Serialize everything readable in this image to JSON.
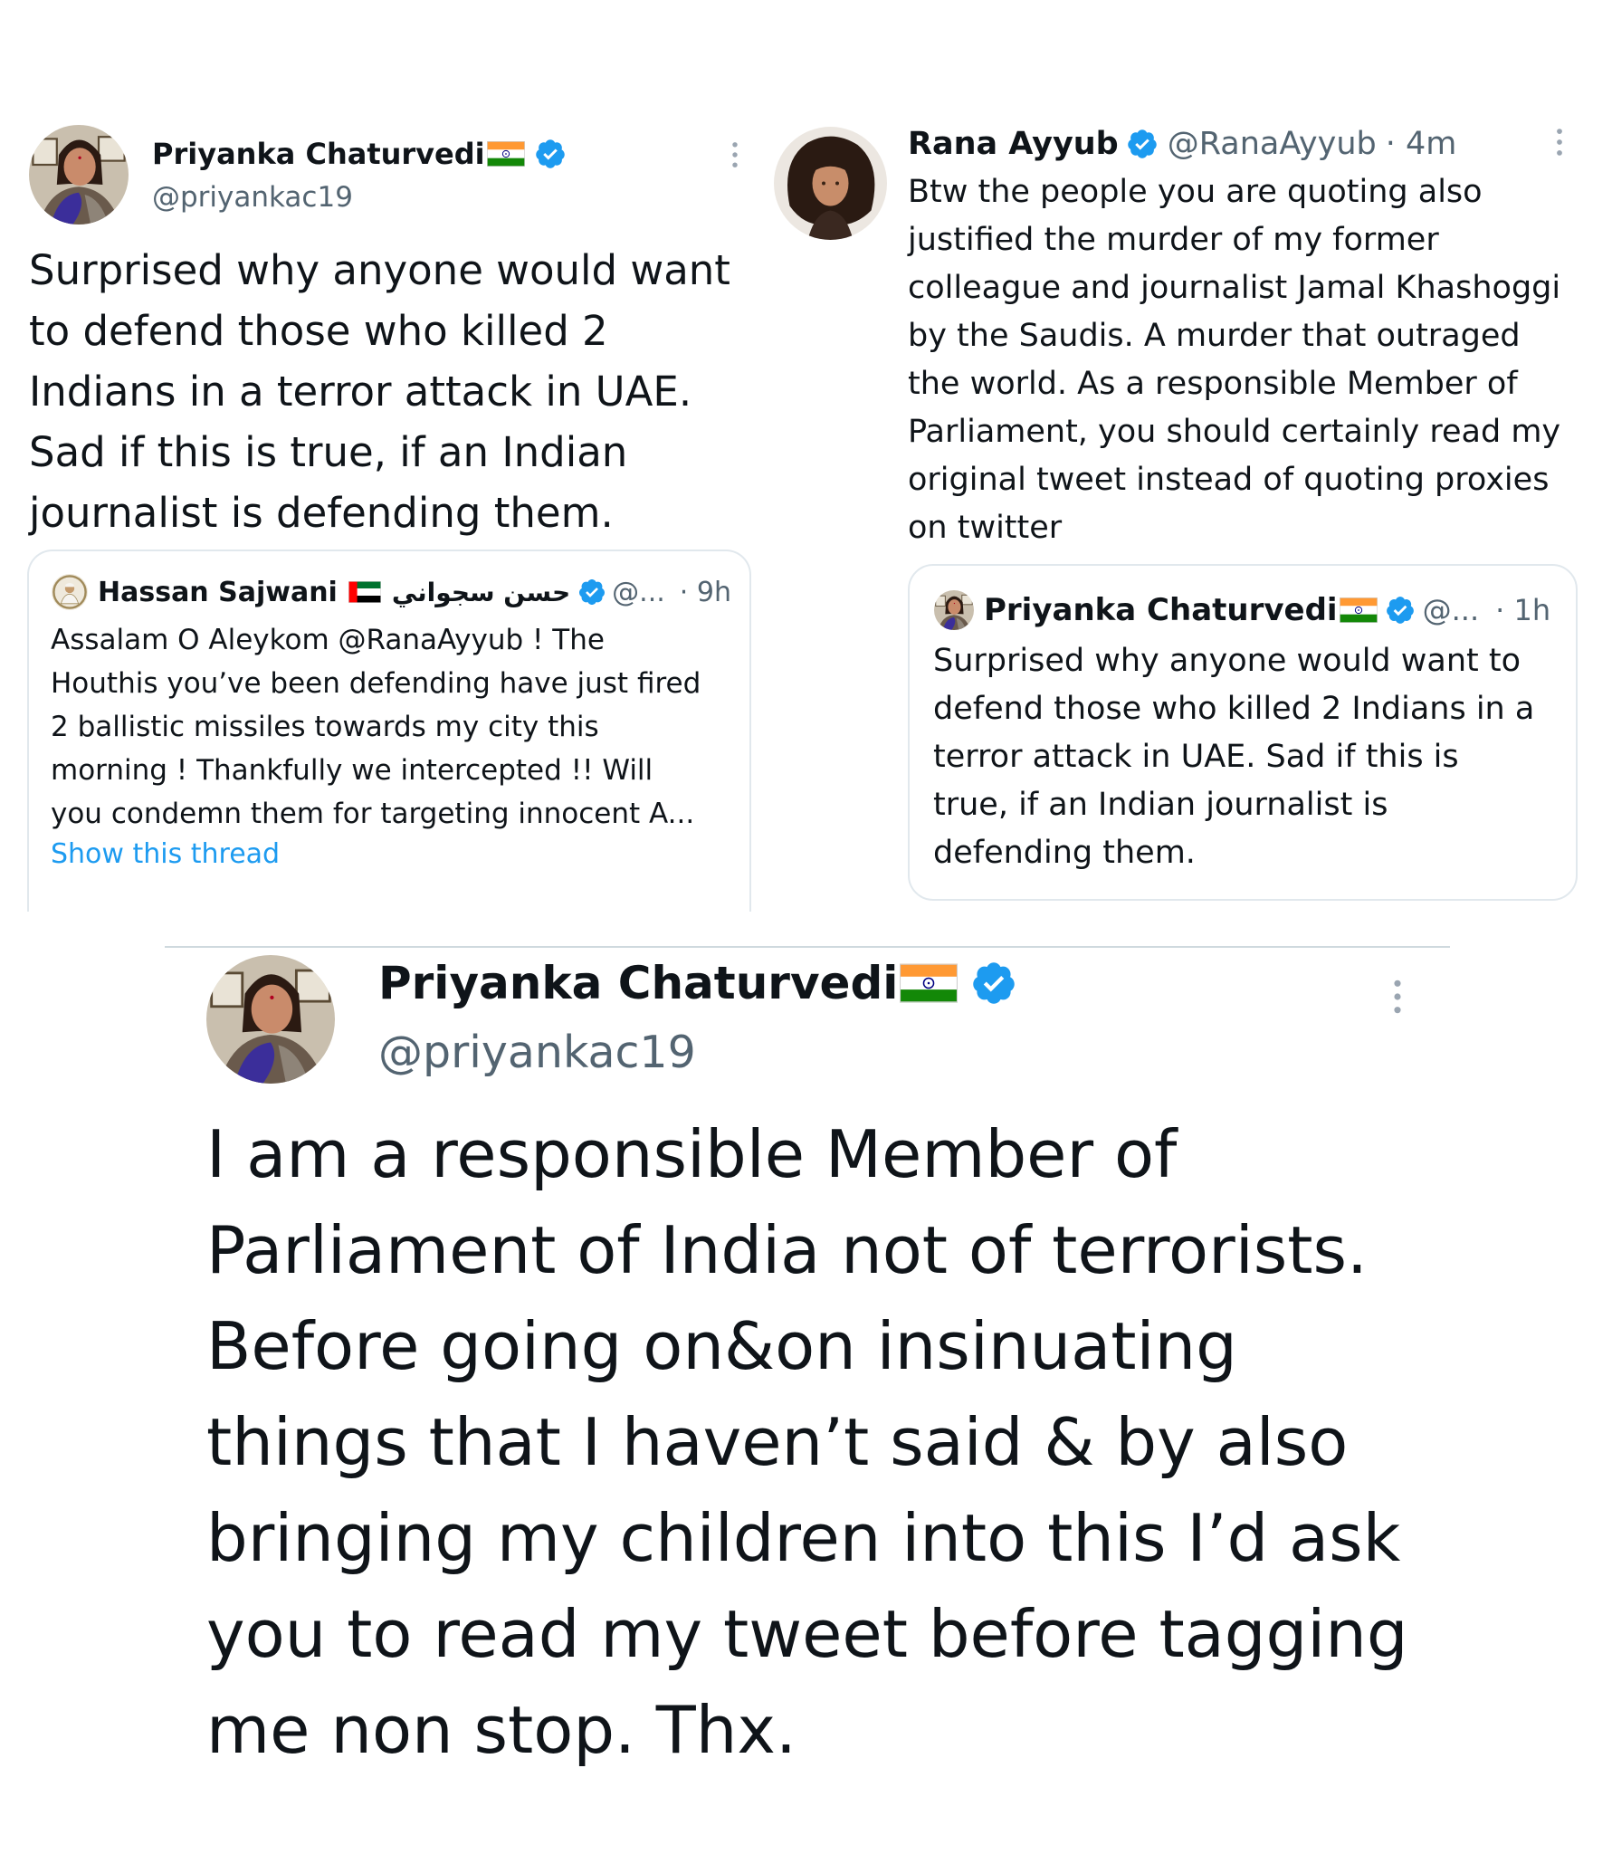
{
  "tweet1": {
    "author_name": "Priyanka Chaturvedi",
    "author_handle": "@priyankac19",
    "text": "Surprised why anyone would want\nto defend those who killed 2\nIndians in a terror  attack in UAE.\nSad if this is true, if an  Indian\njournalist is defending them.",
    "quote": {
      "author_name": "Hassan Sajwani",
      "author_arabic": "حسن سجواني",
      "author_handle": "@...",
      "time": "· 9h",
      "text": "Assalam O Aleykom @RanaAyyub ! The\nHouthis you’ve been defending have just fired\n2 ballistic missiles towards my city this\nmorning ! Thankfully we intercepted !! Will\nyou condemn them for targeting innocent A...",
      "show_thread": "Show this thread"
    }
  },
  "tweet2": {
    "author_name": "Rana Ayyub",
    "author_handle": "@RanaAyyub",
    "time": "· 4m",
    "text": "Btw the people you are quoting also\njustified the murder of my former\ncolleague and journalist Jamal Khashoggi\nby the Saudis. A murder that outraged\nthe world. As a responsible Member of\nParliament, you should certainly read my\noriginal tweet instead of quoting proxies\non twitter",
    "quote": {
      "author_name": "Priyanka Chaturvedi",
      "author_handle": "@...",
      "time": "· 1h",
      "text": "Surprised why anyone would want to\ndefend those who killed 2 Indians in a\nterror  attack in UAE. Sad if this is\ntrue, if an  Indian journalist is\ndefending them."
    }
  },
  "tweet3": {
    "author_name": "Priyanka Chaturvedi",
    "author_handle": "@priyankac19",
    "text": "I am a responsible Member of\nParliament of India not of terrorists.\nBefore going on&on insinuating\nthings that I haven’t said & by also\nbringing my children into this I’d ask\nyou to read my tweet before tagging\nme non stop. Thx."
  },
  "icons": {
    "verified": "verified-badge-icon",
    "more": "more-options-icon",
    "flag_india": "india-flag-icon",
    "flag_uae": "uae-flag-icon"
  },
  "colors": {
    "verified_blue": "#1d9bf0",
    "link_blue": "#1d9bf0",
    "secondary_text": "#536471",
    "border": "#e1e8ed"
  }
}
